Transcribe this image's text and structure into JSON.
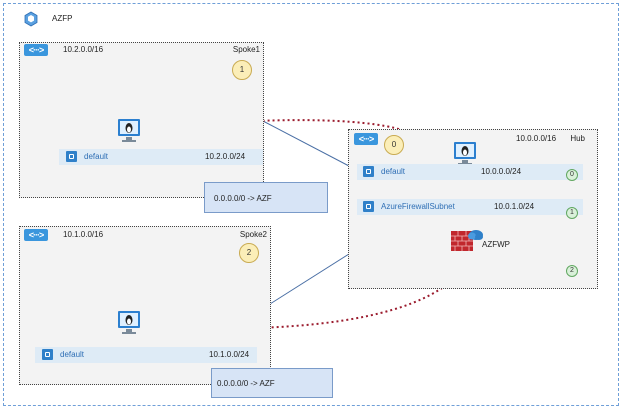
{
  "resource_group": {
    "name": "AZFP",
    "icon": "resource-group-icon"
  },
  "spoke1": {
    "name": "Spoke1",
    "cidr": "10.2.0.0/16",
    "step": "1",
    "subnet": {
      "name": "default",
      "cidr": "10.2.0.0/24"
    },
    "route": "0.0.0.0/0 -> AZF"
  },
  "spoke2": {
    "name": "Spoke2",
    "cidr": "10.1.0.0/16",
    "step": "2",
    "subnet": {
      "name": "default",
      "cidr": "10.1.0.0/24"
    },
    "route": "0.0.0.0/0 -> AZF"
  },
  "hub": {
    "name": "Hub",
    "cidr": "10.0.0.0/16",
    "step": "0",
    "subnets": [
      {
        "name": "default",
        "cidr": "10.0.0.0/24",
        "step": "0"
      },
      {
        "name": "AzureFirewallSubnet",
        "cidr": "10.0.1.0/24",
        "step": "1"
      }
    ],
    "firewall": {
      "name": "AZFWP",
      "icon": "firewall-icon"
    },
    "extra_step": "2"
  },
  "colors": {
    "vnet_icon": "#3a96dd",
    "subnet_fill": "#deebf6",
    "route_fill": "#d7e4f6",
    "traffic_path": "#9b1c2e",
    "peering_line": "#4a6fa5"
  }
}
